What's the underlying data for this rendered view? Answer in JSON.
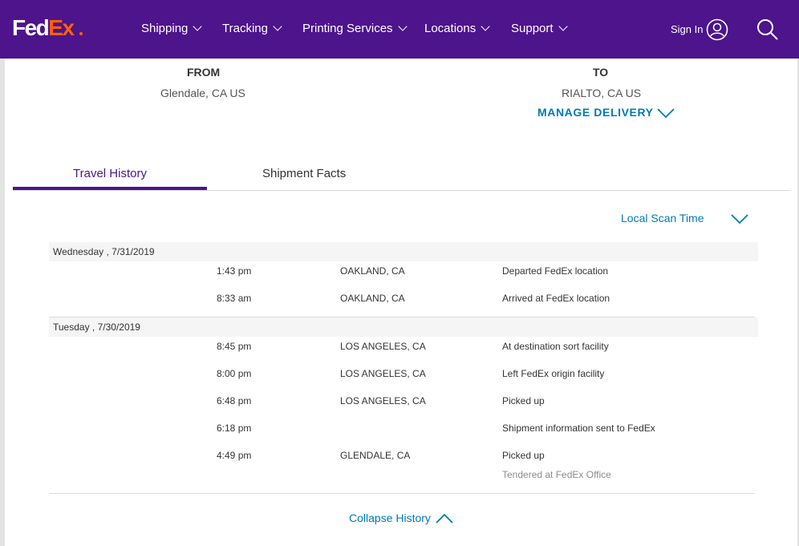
{
  "nav": {
    "logo_fed": "Fed",
    "logo_ex": "Ex",
    "items": [
      {
        "label": "Shipping"
      },
      {
        "label": "Tracking"
      },
      {
        "label": "Printing Services"
      },
      {
        "label": "Locations"
      },
      {
        "label": "Support"
      }
    ],
    "signin": "Sign In",
    "icons": {
      "user": "user-circle-icon",
      "search": "search-icon"
    }
  },
  "shipment": {
    "from_label": "FROM",
    "from_value": "Glendale, CA US",
    "to_label": "TO",
    "to_value": "RIALTO, CA US",
    "manage_delivery": "MANAGE DELIVERY"
  },
  "tabs": [
    {
      "label": "Travel History",
      "active": true
    },
    {
      "label": "Shipment Facts",
      "active": false
    }
  ],
  "history": {
    "scan_time_label": "Local Scan Time",
    "days": [
      {
        "date": "Wednesday , 7/31/2019",
        "events": [
          {
            "time": "1:43 pm",
            "location": "OAKLAND, CA",
            "status": "Departed FedEx location",
            "note": ""
          },
          {
            "time": "8:33 am",
            "location": "OAKLAND, CA",
            "status": "Arrived at FedEx location",
            "note": ""
          }
        ]
      },
      {
        "date": "Tuesday , 7/30/2019",
        "events": [
          {
            "time": "8:45 pm",
            "location": "LOS ANGELES, CA",
            "status": "At destination sort facility",
            "note": ""
          },
          {
            "time": "8:00 pm",
            "location": "LOS ANGELES, CA",
            "status": "Left FedEx origin facility",
            "note": ""
          },
          {
            "time": "6:48 pm",
            "location": "LOS ANGELES, CA",
            "status": "Picked up",
            "note": ""
          },
          {
            "time": "6:18 pm",
            "location": "",
            "status": "Shipment information sent to FedEx",
            "note": ""
          },
          {
            "time": "4:49 pm",
            "location": "GLENDALE, CA",
            "status": "Picked up",
            "note": "Tendered at FedEx Office"
          }
        ]
      }
    ],
    "collapse_label": "Collapse History"
  },
  "colors": {
    "brand_purple": "#4d148c",
    "brand_orange": "#ff6200",
    "link_blue": "#007ab7"
  }
}
